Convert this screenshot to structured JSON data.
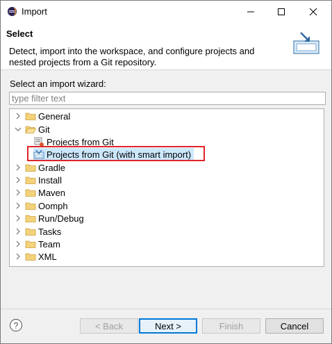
{
  "window": {
    "title": "Import"
  },
  "header": {
    "title": "Select",
    "description": "Detect, import into the workspace, and configure projects and nested projects from a Git repository."
  },
  "main": {
    "prompt_label": "Select an import wizard:",
    "filter_placeholder": "type filter text",
    "filter_value": ""
  },
  "tree": {
    "items": [
      {
        "label": "General",
        "expanded": false,
        "level": 0,
        "icon": "folder-icon"
      },
      {
        "label": "Git",
        "expanded": true,
        "level": 0,
        "icon": "folder-icon"
      },
      {
        "label": "Projects from Git",
        "level": 1,
        "icon": "git-import-icon"
      },
      {
        "label": "Projects from Git (with smart import)",
        "level": 1,
        "icon": "smart-import-icon",
        "selected": true,
        "highlighted": true
      },
      {
        "label": "Gradle",
        "expanded": false,
        "level": 0,
        "icon": "folder-icon"
      },
      {
        "label": "Install",
        "expanded": false,
        "level": 0,
        "icon": "folder-icon"
      },
      {
        "label": "Maven",
        "expanded": false,
        "level": 0,
        "icon": "folder-icon"
      },
      {
        "label": "Oomph",
        "expanded": false,
        "level": 0,
        "icon": "folder-icon"
      },
      {
        "label": "Run/Debug",
        "expanded": false,
        "level": 0,
        "icon": "folder-icon"
      },
      {
        "label": "Tasks",
        "expanded": false,
        "level": 0,
        "icon": "folder-icon"
      },
      {
        "label": "Team",
        "expanded": false,
        "level": 0,
        "icon": "folder-icon"
      },
      {
        "label": "XML",
        "expanded": false,
        "level": 0,
        "icon": "folder-icon"
      }
    ]
  },
  "footer": {
    "back_label": "< Back",
    "next_label": "Next >",
    "finish_label": "Finish",
    "cancel_label": "Cancel"
  },
  "colors": {
    "highlight_border": "#e0242a",
    "default_button_border": "#0078d7",
    "folder": "#e8b84a"
  }
}
